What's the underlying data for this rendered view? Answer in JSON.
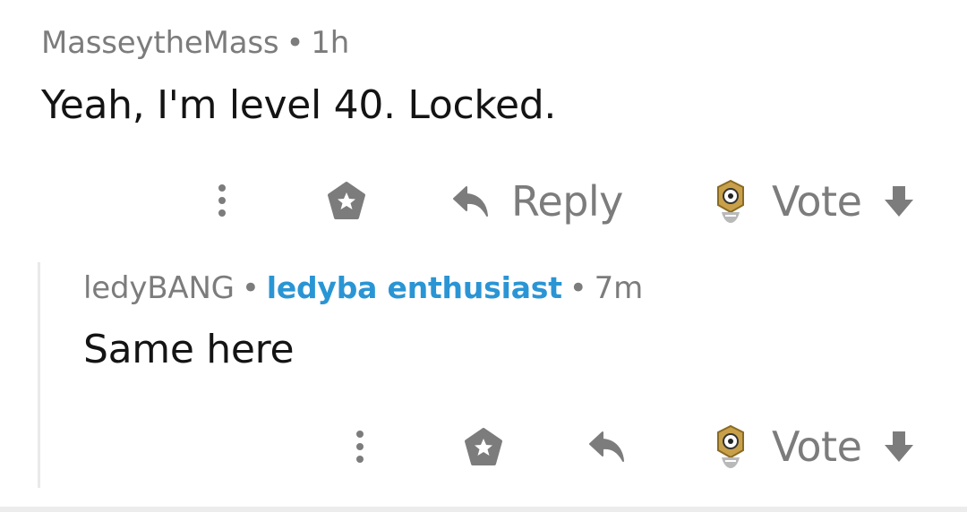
{
  "comments": [
    {
      "author": "MasseytheMass",
      "separator": "•",
      "time": "1h",
      "body": "Yeah, I'm level 40. Locked.",
      "actions": {
        "reply_label": "Reply",
        "vote_label": "Vote"
      }
    },
    {
      "author": "ledyBANG",
      "separator": "•",
      "flair": "ledyba enthusiast",
      "time": "7m",
      "body": "Same here",
      "actions": {
        "reply_label": "",
        "vote_label": "Vote"
      }
    }
  ],
  "icons": {
    "more": "more-vertical-icon",
    "award": "award-icon",
    "reply": "reply-arrow-icon",
    "upvote": "meltan-upvote-icon",
    "downvote": "downvote-arrow-icon"
  },
  "colors": {
    "meta": "#7c7c7c",
    "flair": "#2a95d4",
    "body": "#141414",
    "icon": "#7c7c7c",
    "meltan_gold": "#c9a04a"
  }
}
